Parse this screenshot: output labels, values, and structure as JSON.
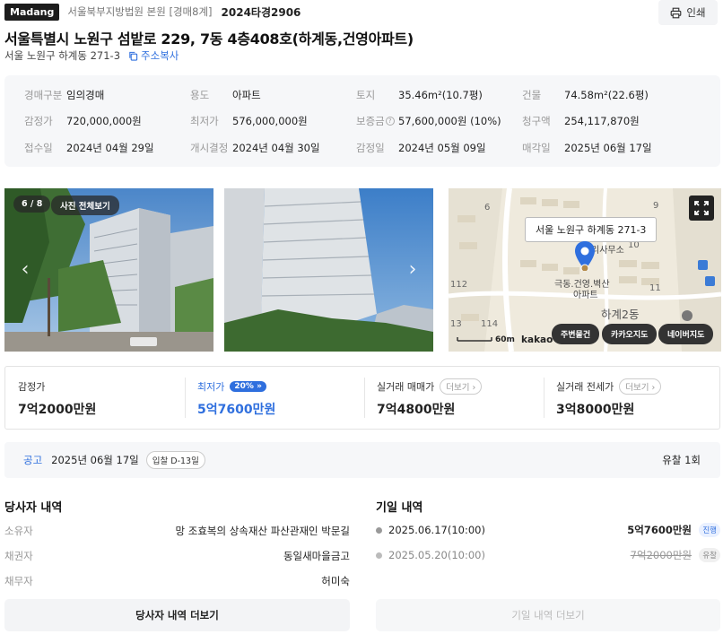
{
  "header": {
    "brand": "Madang",
    "court": "서울북부지방법원 본원 [경매8계]",
    "case_no": "2024타경2906",
    "print_label": "인쇄"
  },
  "property": {
    "title": "서울특별시 노원구 섬밭로 229, 7동 4층408호(하계동,건영아파트)",
    "lot_address": "서울 노원구 하계동 271-3",
    "copy_label": "주소복사"
  },
  "info": [
    {
      "label": "경매구분",
      "value": "임의경매"
    },
    {
      "label": "용도",
      "value": "아파트"
    },
    {
      "label": "토지",
      "value": "35.46m²(10.7평)"
    },
    {
      "label": "건물",
      "value": "74.58m²(22.6평)"
    },
    {
      "label": "감정가",
      "value": "720,000,000원"
    },
    {
      "label": "최저가",
      "value": "576,000,000원"
    },
    {
      "label": "보증금",
      "value": "57,600,000원 (10%)"
    },
    {
      "label": "청구액",
      "value": "254,117,870원"
    },
    {
      "label": "접수일",
      "value": "2024년 04월 29일"
    },
    {
      "label": "개시결정",
      "value": "2024년 04월 30일"
    },
    {
      "label": "감정일",
      "value": "2024년 05월 09일"
    },
    {
      "label": "매각일",
      "value": "2025년 06월 17일"
    }
  ],
  "gallery": {
    "counter": "6 / 8",
    "view_all_label": "사진 전체보기"
  },
  "map": {
    "tooltip": "서울 노원구 하계동 271-3",
    "place_label_1": "리사무소",
    "place_label_2": "극동.건영.벽산",
    "place_label_3": "아파트",
    "district_label": "하계2동",
    "block_numbers": [
      "9",
      "10",
      "11",
      "112",
      "114",
      "13",
      "6"
    ],
    "scale_label": "60m",
    "provider_label": "kakao",
    "chips": [
      "주변물건",
      "카카오지도",
      "네이버지도"
    ]
  },
  "prices": {
    "appraisal_label": "감정가",
    "appraisal_value": "7억2000만원",
    "minimum_label": "최저가",
    "minimum_pct": "20%",
    "minimum_value": "5억7600만원",
    "trade_label": "실거래 매매가",
    "trade_value": "7억4800만원",
    "jeonse_label": "실거래 전세가",
    "jeonse_value": "3억8000만원",
    "more_label": "더보기"
  },
  "notice": {
    "label": "공고",
    "date": "2025년 06월 17일",
    "dday": "입찰 D-13일",
    "fail_count": "유찰 1회"
  },
  "parties": {
    "title": "당사자 내역",
    "rows": [
      {
        "key": "소유자",
        "value": "망 조효복의 상속재산 파산관재인 박문길"
      },
      {
        "key": "채권자",
        "value": "동일새마을금고"
      },
      {
        "key": "채무자",
        "value": "허미숙"
      }
    ],
    "more_button": "당사자 내역 더보기"
  },
  "auctions": {
    "title": "기일 내역",
    "rows": [
      {
        "date": "2025.06.17(10:00)",
        "price": "5억7600만원",
        "status": "진행"
      },
      {
        "date": "2025.05.20(10:00)",
        "price": "7억2000만원",
        "status": "유찰"
      }
    ],
    "more_button": "기일 내역 더보기"
  }
}
